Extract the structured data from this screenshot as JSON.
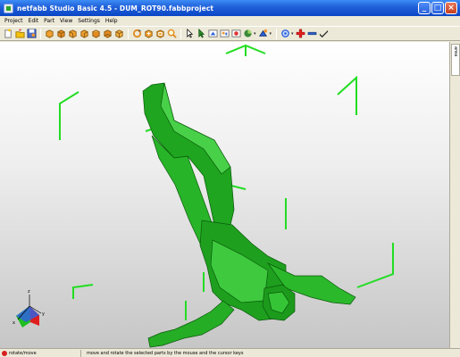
{
  "window": {
    "title": "netfabb Studio Basic 4.5 - DUM_ROT90.fabbproject"
  },
  "menu": {
    "items": [
      "Project",
      "Edit",
      "Part",
      "View",
      "Settings",
      "Help"
    ]
  },
  "side_panel": {
    "tab_label": "Context area"
  },
  "status": {
    "mode": "rotate/move",
    "hint": "move and rotate the selected parts by the mouse and the cursor keys"
  },
  "axes": {
    "x": "x",
    "y": "y",
    "z": "z"
  },
  "colors": {
    "model": "#22b422",
    "bracket": "#22dd22"
  }
}
